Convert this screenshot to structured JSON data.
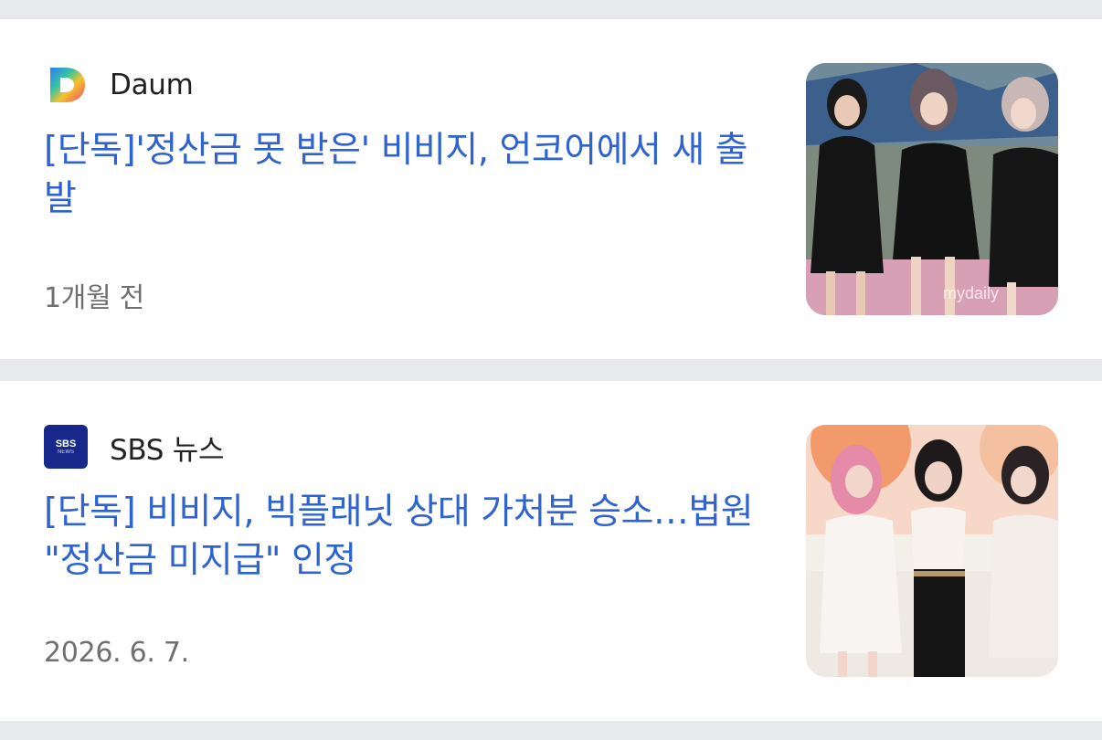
{
  "articles": [
    {
      "source": "Daum",
      "source_icon": "daum-logo-icon",
      "headline": "[단독]'정산금 못 받은' 비비지, 언코어에서 새 출발",
      "time": "1개월 전",
      "thumbnail_watermark": "mydaily"
    },
    {
      "source": "SBS 뉴스",
      "source_icon": "sbs-news-logo-icon",
      "headline": "[단독] 비비지, 빅플래닛 상대 가처분 승소…법원 \"정산금 미지급\" 인정",
      "time": "2026. 6. 7."
    }
  ],
  "colors": {
    "headline": "#2f63d1",
    "background": "#e8e9ec",
    "card": "#ffffff",
    "sbs_brand": "#17288a"
  }
}
